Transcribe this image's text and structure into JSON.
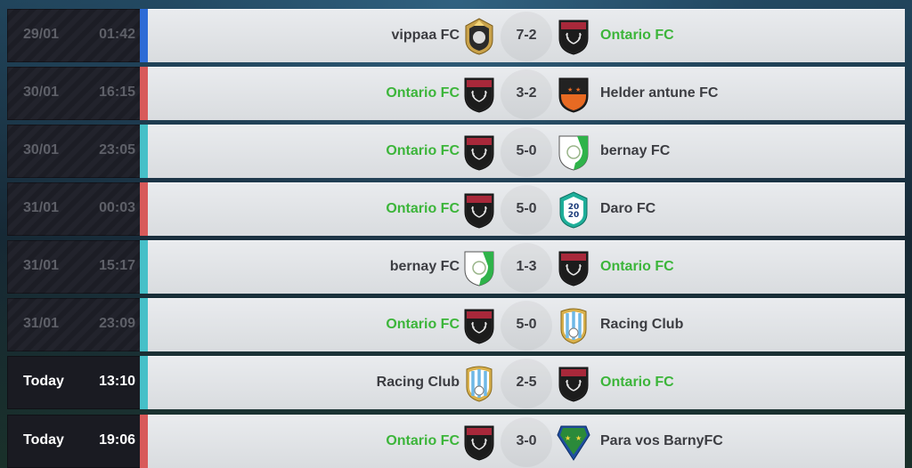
{
  "colors": {
    "win_strip": "#46c0c8",
    "loss_strip": "#d85a5a",
    "home_strip": "#2d6bd6",
    "ontario_name": "#3cb53a",
    "default_name": "#3c3d42"
  },
  "matches": [
    {
      "date": "29/01",
      "time": "01:42",
      "home": "vippaa FC",
      "away": "Ontario FC",
      "score": "7-2",
      "home_crest": "vippaa-crest",
      "away_crest": "ontario-crest",
      "strip": "home"
    },
    {
      "date": "30/01",
      "time": "16:15",
      "home": "Ontario FC",
      "away": "Helder antune FC",
      "score": "3-2",
      "home_crest": "ontario-crest",
      "away_crest": "helder-crest",
      "strip": "loss"
    },
    {
      "date": "30/01",
      "time": "23:05",
      "home": "Ontario FC",
      "away": "bernay FC",
      "score": "5-0",
      "home_crest": "ontario-crest",
      "away_crest": "bernay-crest",
      "strip": "win"
    },
    {
      "date": "31/01",
      "time": "00:03",
      "home": "Ontario FC",
      "away": "Daro FC",
      "score": "5-0",
      "home_crest": "ontario-crest",
      "away_crest": "daro-crest",
      "strip": "loss"
    },
    {
      "date": "31/01",
      "time": "15:17",
      "home": "bernay FC",
      "away": "Ontario FC",
      "score": "1-3",
      "home_crest": "bernay-crest",
      "away_crest": "ontario-crest",
      "strip": "win"
    },
    {
      "date": "31/01",
      "time": "23:09",
      "home": "Ontario FC",
      "away": "Racing Club",
      "score": "5-0",
      "home_crest": "ontario-crest",
      "away_crest": "racing-crest",
      "strip": "win"
    },
    {
      "date": "Today",
      "time": "13:10",
      "home": "Racing Club",
      "away": "Ontario FC",
      "score": "2-5",
      "home_crest": "racing-crest",
      "away_crest": "ontario-crest",
      "strip": "win"
    },
    {
      "date": "Today",
      "time": "19:06",
      "home": "Ontario FC",
      "away": "Para vos BarnyFC",
      "score": "3-0",
      "home_crest": "ontario-crest",
      "away_crest": "paravos-crest",
      "strip": "loss"
    }
  ]
}
